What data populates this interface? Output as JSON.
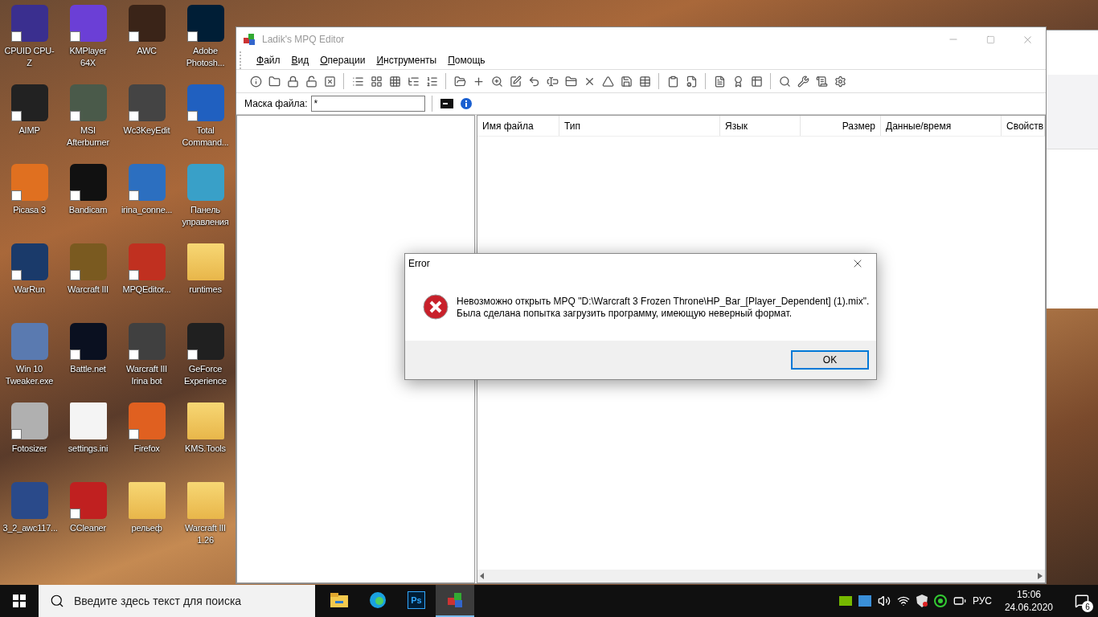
{
  "desktop_icons": [
    {
      "label": "CPUID CPU-Z",
      "kind": "app",
      "shortcut": true
    },
    {
      "label": "KMPlayer 64X",
      "kind": "app",
      "shortcut": true
    },
    {
      "label": "AWC",
      "kind": "app",
      "shortcut": true
    },
    {
      "label": "Adobe Photosh...",
      "kind": "app",
      "shortcut": true
    },
    {
      "label": "AIMP",
      "kind": "app",
      "shortcut": true
    },
    {
      "label": "MSI Afterburner",
      "kind": "app",
      "shortcut": true
    },
    {
      "label": "Wc3KeyEdit",
      "kind": "app",
      "shortcut": true
    },
    {
      "label": "Total Command...",
      "kind": "app",
      "shortcut": true
    },
    {
      "label": "Picasa 3",
      "kind": "app",
      "shortcut": true
    },
    {
      "label": "Bandicam",
      "kind": "app",
      "shortcut": true
    },
    {
      "label": "irina_conne...",
      "kind": "app",
      "shortcut": true
    },
    {
      "label": "Панель управления",
      "kind": "app",
      "shortcut": false
    },
    {
      "label": "WarRun",
      "kind": "app",
      "shortcut": true
    },
    {
      "label": "Warcraft III",
      "kind": "app",
      "shortcut": true
    },
    {
      "label": "MPQEditor...",
      "kind": "app",
      "shortcut": true
    },
    {
      "label": "runtimes",
      "kind": "folder",
      "shortcut": false
    },
    {
      "label": "Win 10 Tweaker.exe",
      "kind": "app",
      "shortcut": false
    },
    {
      "label": "Battle.net",
      "kind": "app",
      "shortcut": true
    },
    {
      "label": "Warcraft III Irina bot",
      "kind": "app",
      "shortcut": true
    },
    {
      "label": "GeForce Experience",
      "kind": "app",
      "shortcut": true
    },
    {
      "label": "Fotosizer",
      "kind": "app",
      "shortcut": true
    },
    {
      "label": "settings.ini",
      "kind": "file",
      "shortcut": false
    },
    {
      "label": "Firefox",
      "kind": "app",
      "shortcut": true
    },
    {
      "label": "KMS.Tools",
      "kind": "folder",
      "shortcut": false
    },
    {
      "label": "3_2_awc117...",
      "kind": "app",
      "shortcut": false
    },
    {
      "label": "CCleaner",
      "kind": "app",
      "shortcut": true
    },
    {
      "label": "рельеф",
      "kind": "folder",
      "shortcut": false
    },
    {
      "label": "Warcraft III 1.26",
      "kind": "folder",
      "shortcut": false
    }
  ],
  "window": {
    "title": "Ladik's MPQ Editor",
    "active": false,
    "menu": [
      "Файл",
      "Вид",
      "Операции",
      "Инструменты",
      "Помощь"
    ],
    "filter": {
      "label": "Маска файла:",
      "value": "*"
    },
    "columns": [
      "Имя файла",
      "Тип",
      "Язык",
      "Размер",
      "Данные/время",
      "Свойств"
    ]
  },
  "dialog": {
    "title": "Error",
    "lines": [
      "Невозможно открыть MPQ \"D:\\Warcraft 3 Frozen Throne\\HP_Bar_[Player_Dependent] (1).mix\".",
      "Была сделана попытка загрузить программу, имеющую неверный формат."
    ],
    "button": "OK"
  },
  "taskbar": {
    "search_placeholder": "Введите здесь текст для поиска",
    "apps": [
      {
        "kind": "explorer",
        "selected": false
      },
      {
        "kind": "edge",
        "selected": false
      },
      {
        "kind": "photoshop",
        "selected": false,
        "label": "Ps"
      },
      {
        "kind": "mpq",
        "selected": true
      }
    ],
    "language": "РУС",
    "time": "15:06",
    "date": "24.06.2020",
    "notifications": "6"
  }
}
